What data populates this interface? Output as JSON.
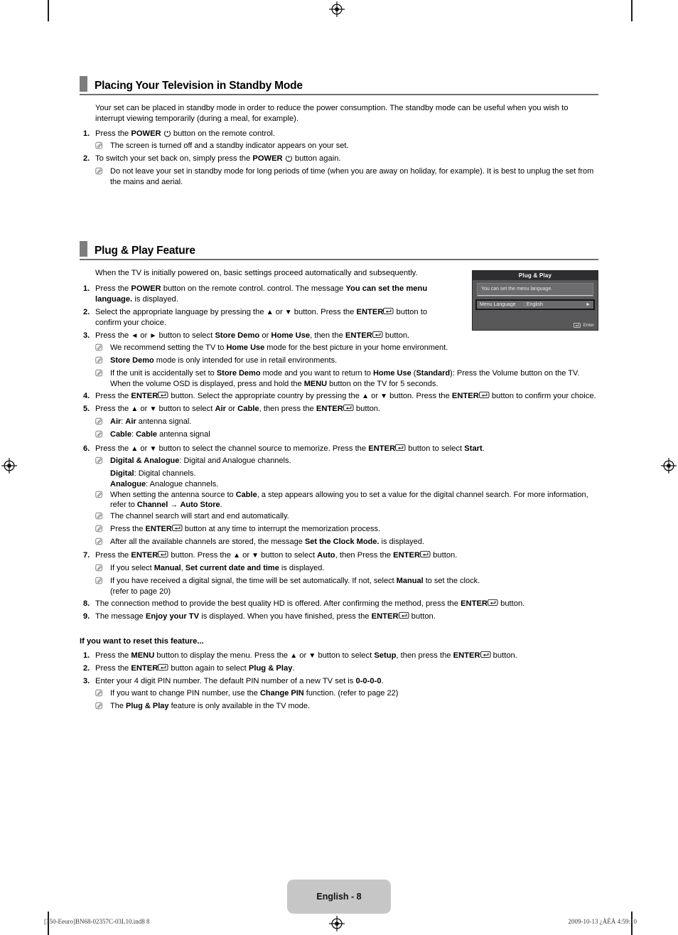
{
  "sections": [
    {
      "title": "Placing Your Television in Standby Mode",
      "intro": "Your set can be placed in standby mode in order to reduce the power consumption. The standby mode can be useful when you wish to interrupt viewing temporarily (during a meal, for example)."
    },
    {
      "title": "Plug & Play Feature",
      "intro": "When the TV is initially powered on, basic settings proceed automatically and subsequently."
    }
  ],
  "standby": {
    "steps": [
      {
        "num": "1.",
        "notes": [
          "The screen is turned off and a standby indicator appears on your set."
        ]
      },
      {
        "num": "2.",
        "notes": [
          "Do not leave your set in standby mode for long periods of time (when you are away on holiday, for example). It is best to unplug the set from the mains and aerial."
        ]
      }
    ],
    "step1_a": "Press the ",
    "step1_power": "POWER",
    "step1_b": " button on the remote control.",
    "step2_a": "To switch your set back on, simply press the ",
    "step2_power": "POWER",
    "step2_b": " button again."
  },
  "plugplay": {
    "steps": [
      {
        "num": "1.",
        "text_parts": [
          "Press the ",
          "POWER",
          " button on the remote control. control. The message ",
          "You can set the menu language.",
          " is displayed."
        ],
        "notes": []
      },
      {
        "num": "2.",
        "text_pre": "Select the appropriate language by pressing the ",
        "text_mid": " button. Press the ",
        "enter": "ENTER",
        "text_post": " button to confirm your choice.",
        "notes": []
      },
      {
        "num": "3.",
        "notes": [
          "We recommend setting the TV to Home Use mode for the best picture in your home environment.",
          "Store Demo mode is only intended for use in retail environments.",
          "If the unit is accidentally set to Store Demo mode and you want to return to Home Use (Standard): Press the Volume button on the TV. When the volume OSD is displayed, press and hold the MENU button on the TV for 5 seconds."
        ]
      },
      {
        "num": "4.",
        "notes": []
      },
      {
        "num": "5.",
        "notes": [
          "Air: Air antenna signal.",
          "Cable: Cable antenna signal"
        ]
      },
      {
        "num": "6.",
        "notes": [
          "Digital & Analogue: Digital and Analogue channels.",
          "When setting the antenna source to Cable, a step appears allowing you to set a value for the digital channel search. For more information, refer to Channel → Auto Store.",
          "The channel search will start and end automatically.",
          "Press the ENTER button at any time to interrupt the memorization process.",
          "After all the available channels are stored, the message Set the Clock Mode. is displayed."
        ],
        "sub_digital": "Digital",
        "sub_digital_rest": ": Digital channels.",
        "sub_analogue": "Analogue",
        "sub_analogue_rest": ": Analogue channels."
      },
      {
        "num": "7.",
        "notes": [
          "If you select Manual, Set current date and time is displayed.",
          "If you have received a digital signal, the time will be set automatically. If not, select Manual to set the clock. (refer to page 20)"
        ]
      },
      {
        "num": "8.",
        "notes": []
      },
      {
        "num": "9.",
        "notes": []
      }
    ],
    "reset_heading": "If you want to reset this feature...",
    "reset_steps": [
      {
        "num": "1."
      },
      {
        "num": "2."
      },
      {
        "num": "3."
      }
    ]
  },
  "text": {
    "s3_a": "Press the ",
    "s3_b": " or ",
    "s3_c": " button to select ",
    "s3_storedemo": "Store Demo",
    "s3_or": " or ",
    "s3_homeuse": "Home Use",
    "s3_d": ", then the ",
    "s3_enter": "ENTER",
    "s3_e": " button.",
    "n3_1_a": "We recommend setting the TV to ",
    "n3_1_b": "Home Use",
    "n3_1_c": " mode for the best picture in your home environment.",
    "n3_2_a": "Store Demo",
    "n3_2_b": " mode is only intended for use in retail environments.",
    "n3_3_a": "If the unit is accidentally set to ",
    "n3_3_b": "Store Demo",
    "n3_3_c": " mode and you want to return to ",
    "n3_3_d": "Home Use",
    "n3_3_e": " (",
    "n3_3_f": "Standard",
    "n3_3_g": "): Press the Volume button on the TV. When the volume OSD is displayed, press and hold the ",
    "n3_3_h": "MENU",
    "n3_3_i": " button on the TV for 5 seconds.",
    "s4_a": "Press the ",
    "s4_enter1": "ENTER",
    "s4_b": " button. Select the appropriate country by pressing the ",
    "s4_c": " button. Press the ",
    "s4_enter2": "ENTER",
    "s4_d": " button to confirm your choice.",
    "s5_a": "Press the ",
    "s5_b": " button to select ",
    "s5_air": "Air",
    "s5_or": " or ",
    "s5_cable": "Cable",
    "s5_c": ", then press the ",
    "s5_enter": "ENTER",
    "s5_d": " button.",
    "n5_1_a": "Air",
    "n5_1_b": ": ",
    "n5_1_c": "Air",
    "n5_1_d": " antenna signal.",
    "n5_2_a": "Cable",
    "n5_2_b": ": ",
    "n5_2_c": "Cable",
    "n5_2_d": " antenna signal",
    "s6_a": "Press the ",
    "s6_b": " button to select the channel source to memorize. Press the ",
    "s6_enter": "ENTER",
    "s6_c": " button to select ",
    "s6_start": "Start",
    "s6_d": ".",
    "n6_1_a": "Digital & Analogue",
    "n6_1_b": ": Digital and Analogue channels.",
    "n6_2_a": "When setting the antenna source to ",
    "n6_2_b": "Cable",
    "n6_2_c": ", a step appears allowing you to set a value for the digital channel search. For more information, refer to ",
    "n6_2_d": "Channel",
    "n6_2_arrow": " → ",
    "n6_2_e": "Auto Store",
    "n6_2_f": ".",
    "n6_3": "The channel search will start and end automatically.",
    "n6_4_a": "Press the ",
    "n6_4_enter": "ENTER",
    "n6_4_b": " button at any time to interrupt the memorization process.",
    "n6_5_a": "After all the available channels are stored, the message ",
    "n6_5_b": "Set the Clock Mode.",
    "n6_5_c": " is displayed.",
    "s7_a": "Press the ",
    "s7_enter1": "ENTER",
    "s7_b": " button. Press the ",
    "s7_c": " button to select ",
    "s7_auto": "Auto",
    "s7_d": ", then Press the ",
    "s7_enter2": "ENTER",
    "s7_e": " button.",
    "n7_1_a": "If you select ",
    "n7_1_b": "Manual",
    "n7_1_c": ", ",
    "n7_1_d": "Set current date and time",
    "n7_1_e": " is displayed.",
    "n7_2_a": "If you have received a digital signal, the time will be set automatically. If not, select ",
    "n7_2_b": "Manual",
    "n7_2_c": " to set the clock.",
    "n7_2_d": "(refer to page 20)",
    "s8_a": "The connection method to provide the best quality HD is offered. After confirming the method, press the ",
    "s8_enter": "ENTER",
    "s8_b": " button.",
    "s9_a": "The message ",
    "s9_b": "Enjoy your TV",
    "s9_c": " is displayed. When you have finished, press the ",
    "s9_enter": "ENTER",
    "s9_d": " button.",
    "r1_a": "Press the ",
    "r1_menu": "MENU",
    "r1_b": " button to display the menu. Press the ",
    "r1_c": " button to select ",
    "r1_setup": "Setup",
    "r1_d": ", then press the ",
    "r1_enter": "ENTER",
    "r1_e": " button.",
    "r2_a": "Press the ",
    "r2_enter": "ENTER",
    "r2_b": " button again to select ",
    "r2_c": "Plug & Play",
    "r2_d": ".",
    "r3_a": "Enter your 4 digit PIN number. The default PIN number of a new TV set is ",
    "r3_pin": "0-0-0-0",
    "r3_b": ".",
    "nr_1_a": "If you want to change PIN number, use the ",
    "nr_1_b": "Change PIN",
    "nr_1_c": " function. (refer to page 22)",
    "nr_2_a": "The ",
    "nr_2_b": "Plug & Play",
    "nr_2_c": " feature is only available in the TV mode."
  },
  "osd": {
    "title": "Plug & Play",
    "message": "You can set the menu language.",
    "row_label": "Menu Language",
    "row_value": ": English",
    "footer_label": "Enter"
  },
  "footer": {
    "page_label": "English - 8",
    "left": "[350-Eeuro]BN68-02357C-03L10.ind8   8",
    "right": "2009-10-13   ¿ÀÈÄ 4:59:10"
  },
  "icons": {
    "power": "power-icon",
    "enter": "enter-icon",
    "note": "note-icon",
    "up": "▲",
    "down": "▼",
    "left": "◄",
    "right": "►"
  },
  "colors": {
    "section_marker": "#7d7d7d",
    "rule": "#6e6e6e",
    "osd_bg": "#58585a",
    "osd_title_bg": "#2e2e30",
    "page_badge": "#c6c6c6"
  }
}
